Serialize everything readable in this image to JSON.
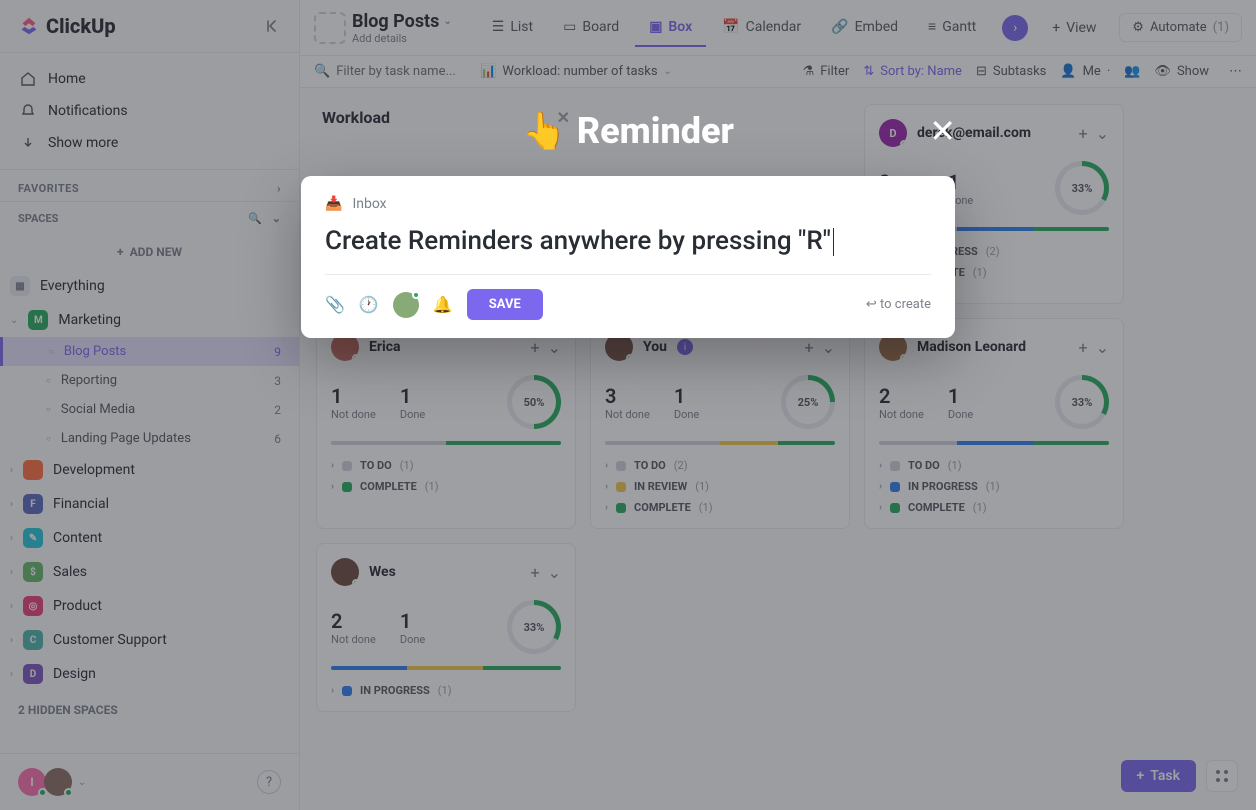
{
  "brand": "ClickUp",
  "sidebar": {
    "nav": {
      "home": "Home",
      "notifications": "Notifications",
      "show_more": "Show more"
    },
    "favorites": "FAVORITES",
    "spaces": "SPACES",
    "add_new": "ADD NEW",
    "everything": "Everything",
    "hidden": "2 HIDDEN SPACES",
    "items": [
      {
        "name": "Marketing",
        "color": "#27ae60",
        "expanded": true,
        "children": [
          {
            "name": "Blog Posts",
            "count": "9",
            "active": true
          },
          {
            "name": "Reporting",
            "count": "3"
          },
          {
            "name": "Social Media",
            "count": "2"
          },
          {
            "name": "Landing Page Updates",
            "count": "6"
          }
        ]
      },
      {
        "name": "Development",
        "color": "#ff7043",
        "letter": "</>"
      },
      {
        "name": "Financial",
        "color": "#5c6bc0",
        "letter": "F"
      },
      {
        "name": "Content",
        "color": "#26c6da",
        "letter": "✎"
      },
      {
        "name": "Sales",
        "color": "#66bb6a",
        "letter": "$"
      },
      {
        "name": "Product",
        "color": "#ec407a",
        "letter": "◎"
      },
      {
        "name": "Customer Support",
        "color": "#4db6ac",
        "letter": "C"
      },
      {
        "name": "Design",
        "color": "#7e57c2",
        "letter": "D"
      }
    ]
  },
  "header": {
    "title": "Blog Posts",
    "subtitle": "Add details",
    "tabs": [
      {
        "label": "List",
        "icon": "list"
      },
      {
        "label": "Board",
        "icon": "board"
      },
      {
        "label": "Box",
        "icon": "box",
        "active": true
      },
      {
        "label": "Calendar",
        "icon": "calendar"
      },
      {
        "label": "Embed",
        "icon": "embed"
      },
      {
        "label": "Gantt",
        "icon": "gantt"
      }
    ],
    "view": "View",
    "automate": "Automate",
    "automate_count": "(1)"
  },
  "toolbar": {
    "filter_placeholder": "Filter by task name...",
    "workload": "Workload: number of tasks",
    "filter": "Filter",
    "sort": "Sort by: Name",
    "subtasks": "Subtasks",
    "me": "Me",
    "show": "Show"
  },
  "board": {
    "workload_title": "Workload",
    "cards": [
      {
        "name": "Erica",
        "color": "#c0695c",
        "not_done": "1",
        "done": "1",
        "pct": "50%",
        "pctv": 50,
        "bars": [
          [
            "#d0d4db",
            50
          ],
          [
            "#27ae60",
            50
          ]
        ],
        "groups": [
          [
            "#d0d4db",
            "TO DO",
            "(1)"
          ],
          [
            "#27ae60",
            "COMPLETE",
            "(1)"
          ]
        ]
      },
      {
        "name": "You",
        "color": "#795548",
        "badge": "i",
        "not_done": "3",
        "done": "1",
        "pct": "25%",
        "pctv": 25,
        "bars": [
          [
            "#d0d4db",
            50
          ],
          [
            "#f2c94c",
            25
          ],
          [
            "#27ae60",
            25
          ]
        ],
        "groups": [
          [
            "#d0d4db",
            "TO DO",
            "(2)"
          ],
          [
            "#f2c94c",
            "IN REVIEW",
            "(1)"
          ],
          [
            "#27ae60",
            "COMPLETE",
            "(1)"
          ]
        ]
      },
      {
        "name": "Madison Leonard",
        "color": "#a1724e",
        "not_done": "2",
        "done": "1",
        "pct": "33%",
        "pctv": 33,
        "bars": [
          [
            "#d0d4db",
            34
          ],
          [
            "#2f80ed",
            33
          ],
          [
            "#27ae60",
            33
          ]
        ],
        "groups": [
          [
            "#d0d4db",
            "TO DO",
            "(1)"
          ],
          [
            "#2f80ed",
            "IN PROGRESS",
            "(1)"
          ],
          [
            "#27ae60",
            "COMPLETE",
            "(1)"
          ]
        ]
      },
      {
        "name": "Wes",
        "color": "#6d4c41",
        "not_done": "2",
        "done": "1",
        "pct": "33%",
        "pctv": 33,
        "bars": [
          [
            "#2f80ed",
            33
          ],
          [
            "#f2c94c",
            33
          ],
          [
            "#27ae60",
            34
          ]
        ],
        "groups": [
          [
            "#2f80ed",
            "IN PROGRESS",
            "(1)"
          ]
        ]
      }
    ],
    "top": {
      "user2": {
        "name": "derek@email.com",
        "letter": "D",
        "color": "#9c27b0",
        "not_done": "2",
        "done": "1",
        "pct": "33%",
        "pctv": 33,
        "bars": [
          [
            "#d0d4db",
            34
          ],
          [
            "#2f80ed",
            33
          ],
          [
            "#27ae60",
            33
          ]
        ],
        "groups": [
          [
            "#2f80ed",
            "IN PROGRESS",
            "(2)"
          ],
          [
            "#27ae60",
            "COMPLETE",
            "(1)"
          ]
        ]
      }
    },
    "not_done_lbl": "Not done",
    "done_lbl": "Done"
  },
  "task_label": "Task",
  "modal": {
    "title": "Reminder",
    "inbox": "Inbox",
    "text": "Create Reminders anywhere by pressing \"R\"",
    "save": "SAVE",
    "hint": "to create"
  }
}
